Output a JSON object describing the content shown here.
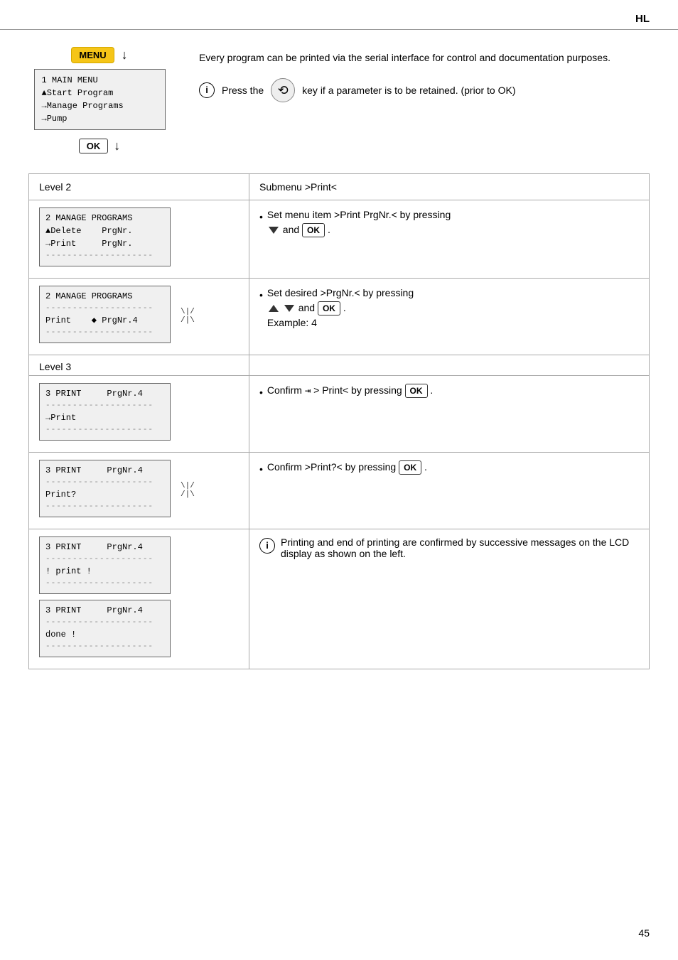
{
  "header": {
    "label": "HL"
  },
  "menu_section": {
    "menu_label": "MENU",
    "arrow": "↓",
    "lcd_lines": [
      "1 MAIN MENU",
      "▲Start Program",
      "→Manage Programs",
      "→Pump"
    ],
    "ok_label": "OK",
    "ok_arrow": "↓"
  },
  "intro_text": "Every program can be printed via the serial interface for control and documentation purposes.",
  "info_note": "Press the",
  "info_note2": "key if a parameter is to be retained. (prior to OK)",
  "table": {
    "col1_header": "Level 2",
    "col2_header": "Submenu >Print<",
    "rows": [
      {
        "lcd1_lines": [
          "2 MANAGE PROGRAMS",
          "▲Delete    PrgNr.",
          "→Print     PrgNr.",
          "--------------------"
        ],
        "bullet": "Set menu item >Print PrgNr.< by pressing",
        "bullet_extra": "and OK ."
      },
      {
        "lcd2_lines": [
          "2 MANAGE PROGRAMS",
          "--------------------",
          "Print    ♦ PrgNr.4",
          "--------------------"
        ],
        "has_nav": true,
        "bullet": "Set desired >PrgNr.< by pressing",
        "bullet_extra": "and OK .",
        "example": "Example: 4"
      }
    ],
    "level3_label": "Level 3",
    "level3_rows": [
      {
        "lcd_lines": [
          "3 PRINT     PrgNr.4",
          "--------------------",
          "→Print",
          "--------------------"
        ],
        "bullet": "Confirm",
        "confirm_sym": "⇥",
        "bullet_mid": "> Print< by pressing",
        "ok_label": "OK"
      },
      {
        "lcd_lines": [
          "3 PRINT     PrgNr.4",
          "--------------------",
          "Print?",
          "--------------------"
        ],
        "has_nav": true,
        "bullet": "Confirm >Print?< by pressing",
        "ok_label": "OK"
      },
      {
        "lcd_lines1": [
          "3 PRINT     PrgNr.4",
          "--------------------",
          "! print !",
          "--------------------"
        ],
        "lcd_lines2": [
          "3 PRINT     PrgNr.4",
          "--------------------",
          "done !",
          "--------------------"
        ],
        "info": "Printing and end of printing are confirmed by successive messages on the LCD display as shown on the left."
      }
    ]
  },
  "page_number": "45"
}
